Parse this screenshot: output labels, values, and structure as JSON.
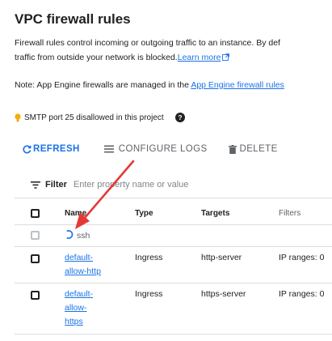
{
  "page": {
    "title": "VPC firewall rules",
    "description_line1": "Firewall rules control incoming or outgoing traffic to an instance. By def",
    "description_line2": "traffic from outside your network is blocked.",
    "learn_more": "Learn more",
    "note_prefix": "Note: App Engine firewalls are managed in the ",
    "note_link": "App Engine firewall rules"
  },
  "smtp": {
    "text": "SMTP port 25 disallowed in this project"
  },
  "toolbar": {
    "refresh": "REFRESH",
    "configure_logs": "CONFIGURE LOGS",
    "delete": "DELETE"
  },
  "filter": {
    "label": "Filter",
    "placeholder": "Enter property name or value"
  },
  "table": {
    "columns": [
      "Name",
      "Type",
      "Targets",
      "Filters"
    ],
    "pending_row": {
      "name": "ssh"
    },
    "rows": [
      {
        "name_parts": [
          "default-",
          "allow-http"
        ],
        "type": "Ingress",
        "targets": "http-server",
        "filters": "IP ranges: 0"
      },
      {
        "name_parts": [
          "default-",
          "allow-",
          "https"
        ],
        "type": "Ingress",
        "targets": "https-server",
        "filters": "IP ranges: 0"
      }
    ]
  },
  "colors": {
    "accent": "#1a73e8",
    "text": "#202124",
    "muted": "#5f6368",
    "divider": "#dadce0",
    "warning_bulb": "#f9ab00",
    "annotation_arrow": "#e53935"
  }
}
